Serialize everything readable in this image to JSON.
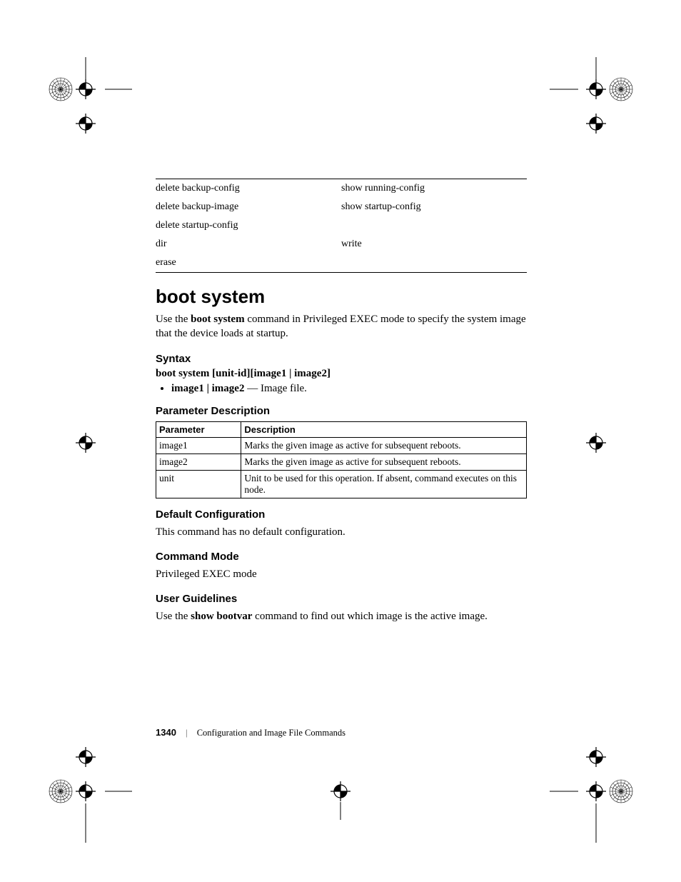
{
  "related_commands": {
    "col1": [
      "delete backup-config",
      "delete backup-image",
      "delete startup-config",
      "dir",
      "erase"
    ],
    "col2": [
      "show running-config",
      "show startup-config",
      "",
      "write",
      ""
    ]
  },
  "section_title": "boot system",
  "intro_pre": "Use the ",
  "intro_bold": "boot system",
  "intro_post": " command in Privileged EXEC mode to specify the system image that the device loads at startup.",
  "syntax": {
    "heading": "Syntax",
    "line": "boot system [unit-id][image1 | image2]",
    "bullet_bold": "image1 | image2",
    "bullet_rest": " — Image file."
  },
  "param_desc": {
    "heading": "Parameter Description",
    "header_param": "Parameter",
    "header_desc": "Description",
    "rows": [
      {
        "p": "image1",
        "d": "Marks the given image as active for subsequent reboots."
      },
      {
        "p": "image2",
        "d": "Marks the given image as active for subsequent reboots."
      },
      {
        "p": "unit",
        "d": "Unit to be used for this operation. If absent, command executes on this node."
      }
    ]
  },
  "default_cfg": {
    "heading": "Default Configuration",
    "body": "This command has no default configuration."
  },
  "cmd_mode": {
    "heading": "Command Mode",
    "body": "Privileged EXEC mode"
  },
  "user_guidelines": {
    "heading": "User Guidelines",
    "pre": "Use the ",
    "bold": "show bootvar",
    "post": " command to find out which image is the active image."
  },
  "footer": {
    "page_number": "1340",
    "chapter": "Configuration and Image File Commands"
  }
}
